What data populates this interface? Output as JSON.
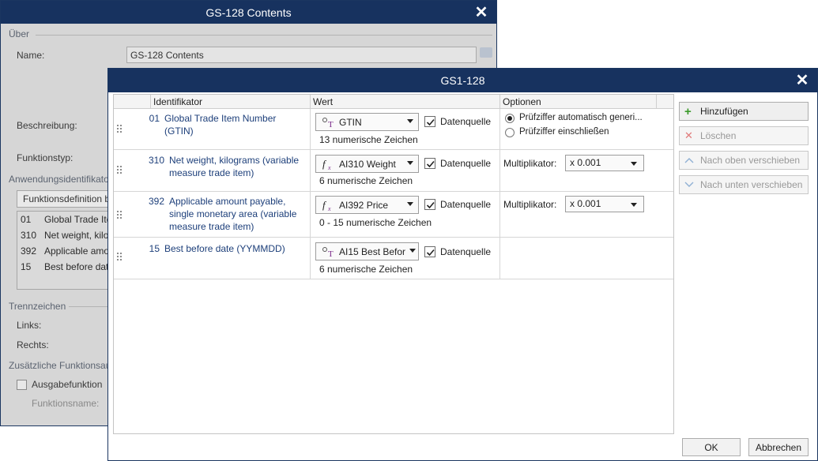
{
  "background_window": {
    "title": "GS-128 Contents",
    "section_about": "Über",
    "name_label": "Name:",
    "name_value": "GS-128 Contents",
    "description_label": "Beschreibung:",
    "function_type_label": "Funktionstyp:",
    "ai_section": "Anwendungsidentifikato",
    "function_definition_button": "Funktionsdefinition b",
    "ai_list": [
      {
        "code": "01",
        "name": "Global Trade Ite"
      },
      {
        "code": "310",
        "name": "Net weight, kilo"
      },
      {
        "code": "392",
        "name": "Applicable amo"
      },
      {
        "code": "15",
        "name": "Best before dat"
      }
    ],
    "separators_section": "Trennzeichen",
    "left_label": "Links:",
    "right_label": "Rechts:",
    "extra_section": "Zusätzliche Funktionsau",
    "output_function_label": "Ausgabefunktion",
    "function_name_label": "Funktionsname:"
  },
  "dialog": {
    "title": "GS1-128",
    "columns": {
      "identifier": "Identifikator",
      "value": "Wert",
      "options": "Optionen"
    },
    "rows": [
      {
        "code": "01",
        "name": "Global Trade Item Number (GTIN)",
        "combo_icon": "database-variable-icon",
        "combo_value": "GTIN",
        "data_source_label": "Datenquelle",
        "data_source_checked": true,
        "hint": "13 numerische Zeichen",
        "options": {
          "radio_1": "Prüfziffer automatisch generi...",
          "radio_2": "Prüfziffer einschließen",
          "radio_selected": 1
        }
      },
      {
        "code": "310",
        "name": "Net weight, kilograms (variable measure trade item)",
        "combo_icon": "function-icon",
        "combo_value": "AI310 Weight",
        "data_source_label": "Datenquelle",
        "data_source_checked": true,
        "hint": "6 numerische Zeichen",
        "options": {
          "multiplier_label": "Multiplikator:",
          "multiplier_value": "x 0.001"
        }
      },
      {
        "code": "392",
        "name": "Applicable amount payable, single monetary area (variable measure trade item)",
        "combo_icon": "function-icon",
        "combo_value": "AI392 Price",
        "data_source_label": "Datenquelle",
        "data_source_checked": true,
        "hint": "0 - 15 numerische Zeichen",
        "options": {
          "multiplier_label": "Multiplikator:",
          "multiplier_value": "x 0.001"
        }
      },
      {
        "code": "15",
        "name": "Best before date (YYMMDD)",
        "combo_icon": "database-variable-icon",
        "combo_value": "AI15 Best Befor",
        "data_source_label": "Datenquelle",
        "data_source_checked": true,
        "hint": "6 numerische Zeichen"
      }
    ],
    "side_buttons": {
      "add": "Hinzufügen",
      "delete": "Löschen",
      "move_up": "Nach oben verschieben",
      "move_down": "Nach unten verschieben"
    },
    "ok": "OK",
    "cancel": "Abbrechen"
  },
  "colors": {
    "titlebar": "#17325f",
    "link_text": "#1d3f7a",
    "add_icon": "#3a9a2a",
    "delete_icon": "#e07a7a"
  }
}
